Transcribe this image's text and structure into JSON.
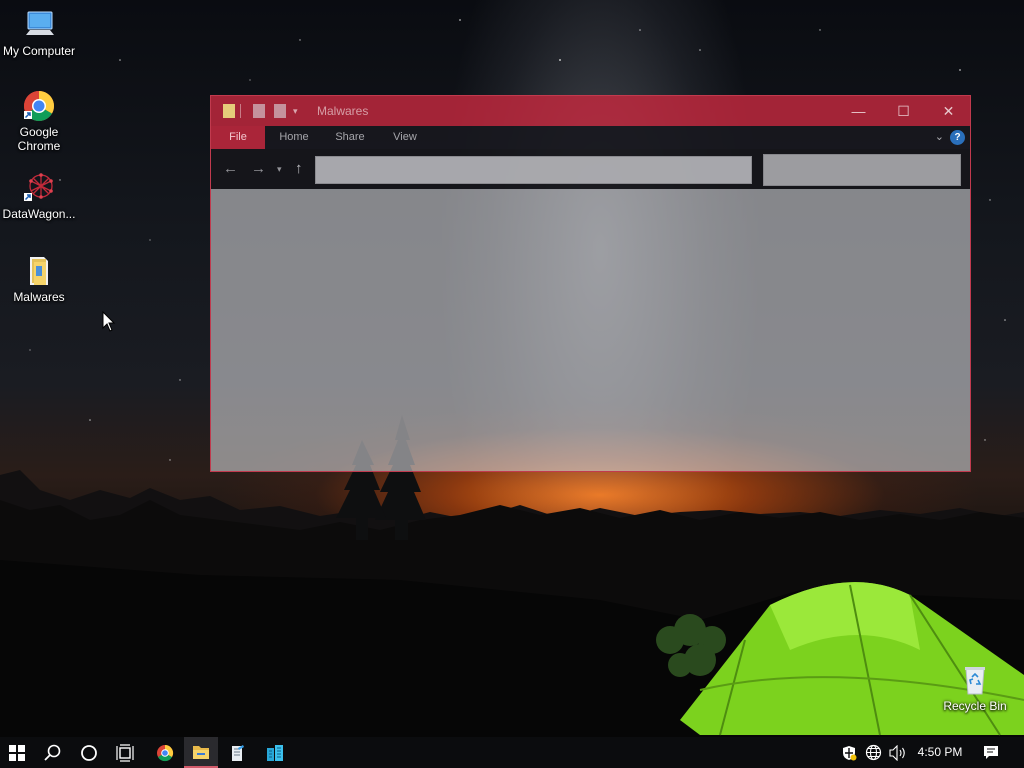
{
  "desktop": {
    "icons": [
      {
        "label": "My Computer",
        "icon": "computer-icon"
      },
      {
        "label": "Google Chrome",
        "icon": "chrome-icon"
      },
      {
        "label": "DataWagon...",
        "icon": "datawagon-icon"
      },
      {
        "label": "Malwares",
        "icon": "folder-icon"
      },
      {
        "label": "Recycle Bin",
        "icon": "recycle-bin-icon"
      }
    ]
  },
  "window": {
    "title": "Malwares",
    "accent": "#c4283e",
    "tabs": [
      "File",
      "Home",
      "Share",
      "View"
    ],
    "address_value": "",
    "search_placeholder": "",
    "controls": {
      "minimize": "—",
      "maximize": "☐",
      "close": "✕"
    },
    "help": "?"
  },
  "taskbar": {
    "items": [
      "start-icon",
      "search-icon",
      "cortana-icon",
      "task-view-icon",
      "chrome-icon",
      "file-explorer-icon",
      "notepad-icon",
      "apps-icon"
    ],
    "active_item": "file-explorer-icon",
    "tray": [
      "defender-icon",
      "network-icon",
      "volume-icon"
    ],
    "clock": "4:50 PM",
    "notifications_icon": "action-center-icon"
  }
}
